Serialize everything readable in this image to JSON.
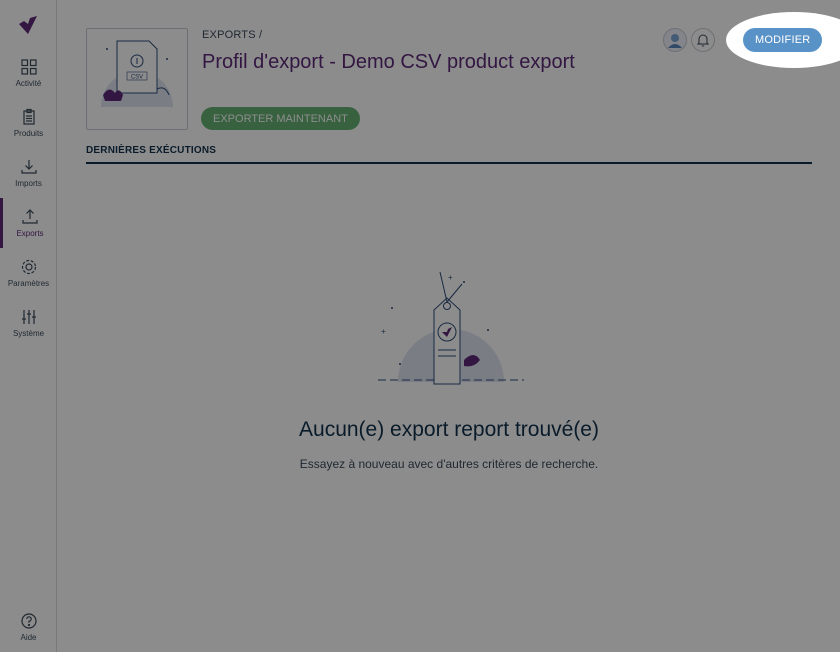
{
  "sidebar": {
    "items": [
      {
        "label": "Activité",
        "icon": "grid-icon"
      },
      {
        "label": "Produits",
        "icon": "clipboard-icon"
      },
      {
        "label": "Imports",
        "icon": "download-icon"
      },
      {
        "label": "Exports",
        "icon": "upload-icon",
        "active": true
      },
      {
        "label": "Paramètres",
        "icon": "gear-icon"
      },
      {
        "label": "Système",
        "icon": "sliders-icon"
      }
    ],
    "help_label": "Aide"
  },
  "header": {
    "breadcrumb": "EXPORTS /",
    "title": "Profil d'export - Demo CSV product export",
    "export_button": "EXPORTER MAINTENANT",
    "modify_button": "MODIFIER",
    "thumb_badge": "CSV"
  },
  "section": {
    "title": "DERNIÈRES EXÉCUTIONS"
  },
  "empty": {
    "title": "Aucun(e) export report trouvé(e)",
    "subtitle": "Essayez à nouveau avec d'autres critères de recherche."
  },
  "colors": {
    "brand_purple": "#5e2a78",
    "export_green": "#67b373",
    "modify_blue": "#5992c7",
    "overlay": "#8c8c8c"
  }
}
